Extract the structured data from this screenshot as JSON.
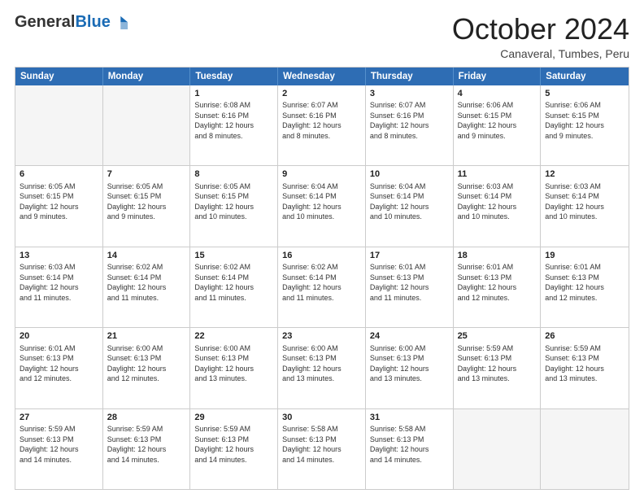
{
  "logo": {
    "general": "General",
    "blue": "Blue"
  },
  "header": {
    "month": "October 2024",
    "location": "Canaveral, Tumbes, Peru"
  },
  "weekdays": [
    "Sunday",
    "Monday",
    "Tuesday",
    "Wednesday",
    "Thursday",
    "Friday",
    "Saturday"
  ],
  "rows": [
    [
      {
        "day": "",
        "text": ""
      },
      {
        "day": "",
        "text": ""
      },
      {
        "day": "1",
        "text": "Sunrise: 6:08 AM\nSunset: 6:16 PM\nDaylight: 12 hours\nand 8 minutes."
      },
      {
        "day": "2",
        "text": "Sunrise: 6:07 AM\nSunset: 6:16 PM\nDaylight: 12 hours\nand 8 minutes."
      },
      {
        "day": "3",
        "text": "Sunrise: 6:07 AM\nSunset: 6:16 PM\nDaylight: 12 hours\nand 8 minutes."
      },
      {
        "day": "4",
        "text": "Sunrise: 6:06 AM\nSunset: 6:15 PM\nDaylight: 12 hours\nand 9 minutes."
      },
      {
        "day": "5",
        "text": "Sunrise: 6:06 AM\nSunset: 6:15 PM\nDaylight: 12 hours\nand 9 minutes."
      }
    ],
    [
      {
        "day": "6",
        "text": "Sunrise: 6:05 AM\nSunset: 6:15 PM\nDaylight: 12 hours\nand 9 minutes."
      },
      {
        "day": "7",
        "text": "Sunrise: 6:05 AM\nSunset: 6:15 PM\nDaylight: 12 hours\nand 9 minutes."
      },
      {
        "day": "8",
        "text": "Sunrise: 6:05 AM\nSunset: 6:15 PM\nDaylight: 12 hours\nand 10 minutes."
      },
      {
        "day": "9",
        "text": "Sunrise: 6:04 AM\nSunset: 6:14 PM\nDaylight: 12 hours\nand 10 minutes."
      },
      {
        "day": "10",
        "text": "Sunrise: 6:04 AM\nSunset: 6:14 PM\nDaylight: 12 hours\nand 10 minutes."
      },
      {
        "day": "11",
        "text": "Sunrise: 6:03 AM\nSunset: 6:14 PM\nDaylight: 12 hours\nand 10 minutes."
      },
      {
        "day": "12",
        "text": "Sunrise: 6:03 AM\nSunset: 6:14 PM\nDaylight: 12 hours\nand 10 minutes."
      }
    ],
    [
      {
        "day": "13",
        "text": "Sunrise: 6:03 AM\nSunset: 6:14 PM\nDaylight: 12 hours\nand 11 minutes."
      },
      {
        "day": "14",
        "text": "Sunrise: 6:02 AM\nSunset: 6:14 PM\nDaylight: 12 hours\nand 11 minutes."
      },
      {
        "day": "15",
        "text": "Sunrise: 6:02 AM\nSunset: 6:14 PM\nDaylight: 12 hours\nand 11 minutes."
      },
      {
        "day": "16",
        "text": "Sunrise: 6:02 AM\nSunset: 6:14 PM\nDaylight: 12 hours\nand 11 minutes."
      },
      {
        "day": "17",
        "text": "Sunrise: 6:01 AM\nSunset: 6:13 PM\nDaylight: 12 hours\nand 11 minutes."
      },
      {
        "day": "18",
        "text": "Sunrise: 6:01 AM\nSunset: 6:13 PM\nDaylight: 12 hours\nand 12 minutes."
      },
      {
        "day": "19",
        "text": "Sunrise: 6:01 AM\nSunset: 6:13 PM\nDaylight: 12 hours\nand 12 minutes."
      }
    ],
    [
      {
        "day": "20",
        "text": "Sunrise: 6:01 AM\nSunset: 6:13 PM\nDaylight: 12 hours\nand 12 minutes."
      },
      {
        "day": "21",
        "text": "Sunrise: 6:00 AM\nSunset: 6:13 PM\nDaylight: 12 hours\nand 12 minutes."
      },
      {
        "day": "22",
        "text": "Sunrise: 6:00 AM\nSunset: 6:13 PM\nDaylight: 12 hours\nand 13 minutes."
      },
      {
        "day": "23",
        "text": "Sunrise: 6:00 AM\nSunset: 6:13 PM\nDaylight: 12 hours\nand 13 minutes."
      },
      {
        "day": "24",
        "text": "Sunrise: 6:00 AM\nSunset: 6:13 PM\nDaylight: 12 hours\nand 13 minutes."
      },
      {
        "day": "25",
        "text": "Sunrise: 5:59 AM\nSunset: 6:13 PM\nDaylight: 12 hours\nand 13 minutes."
      },
      {
        "day": "26",
        "text": "Sunrise: 5:59 AM\nSunset: 6:13 PM\nDaylight: 12 hours\nand 13 minutes."
      }
    ],
    [
      {
        "day": "27",
        "text": "Sunrise: 5:59 AM\nSunset: 6:13 PM\nDaylight: 12 hours\nand 14 minutes."
      },
      {
        "day": "28",
        "text": "Sunrise: 5:59 AM\nSunset: 6:13 PM\nDaylight: 12 hours\nand 14 minutes."
      },
      {
        "day": "29",
        "text": "Sunrise: 5:59 AM\nSunset: 6:13 PM\nDaylight: 12 hours\nand 14 minutes."
      },
      {
        "day": "30",
        "text": "Sunrise: 5:58 AM\nSunset: 6:13 PM\nDaylight: 12 hours\nand 14 minutes."
      },
      {
        "day": "31",
        "text": "Sunrise: 5:58 AM\nSunset: 6:13 PM\nDaylight: 12 hours\nand 14 minutes."
      },
      {
        "day": "",
        "text": ""
      },
      {
        "day": "",
        "text": ""
      }
    ]
  ]
}
